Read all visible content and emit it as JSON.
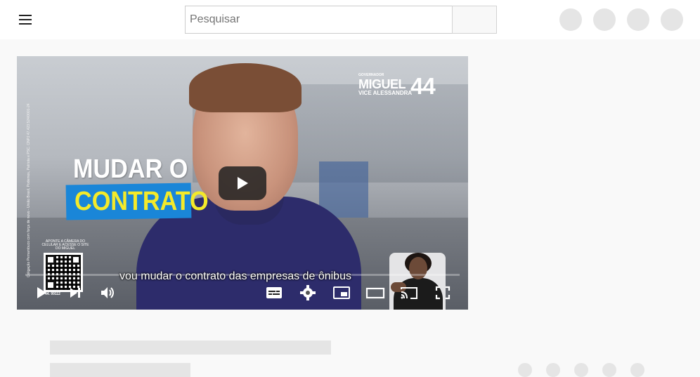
{
  "header": {
    "search_placeholder": "Pesquisar",
    "menu_icon": "hamburger-menu-icon",
    "search_icon": "search-icon",
    "right_buttons": [
      "create-icon",
      "apps-icon",
      "notifications-icon",
      "avatar"
    ]
  },
  "video": {
    "overlay_headline_line1": "MUDAR O",
    "overlay_headline_line2": "CONTRATO",
    "logo_label": "GOVERNADOR",
    "logo_name": "MIGUEL",
    "logo_vice": "VICE ALESSANDRA",
    "logo_number": "44",
    "side_disclaimer": "Coligação Pernambuco com força de novo - União Brasil, Podemos, Patriota e PSC. CNPJ 47.423.524/0001-24",
    "qr_caption": "APONTE A CÂMERA DO CELULAR E ACESSE O SITE DO MIGUEL",
    "qr_label": "44. 99112",
    "caption": "vou mudar o contrato das empresas de ônibus",
    "progress": 0,
    "controls": {
      "play": "play-icon",
      "next": "skip-next-icon",
      "volume": "volume-icon",
      "subtitles": "subtitles-icon",
      "settings": "settings-gear-icon",
      "miniplayer": "miniplayer-icon",
      "theater": "theater-mode-icon",
      "cast": "cast-icon",
      "fullscreen": "fullscreen-icon"
    }
  },
  "colors": {
    "topbar": "#ffffff",
    "page_bg": "#f9f9f9",
    "skeleton": "#e5e5e5",
    "headline_yellow": "#f4ea2a",
    "headline_blue": "#1a86d8"
  }
}
